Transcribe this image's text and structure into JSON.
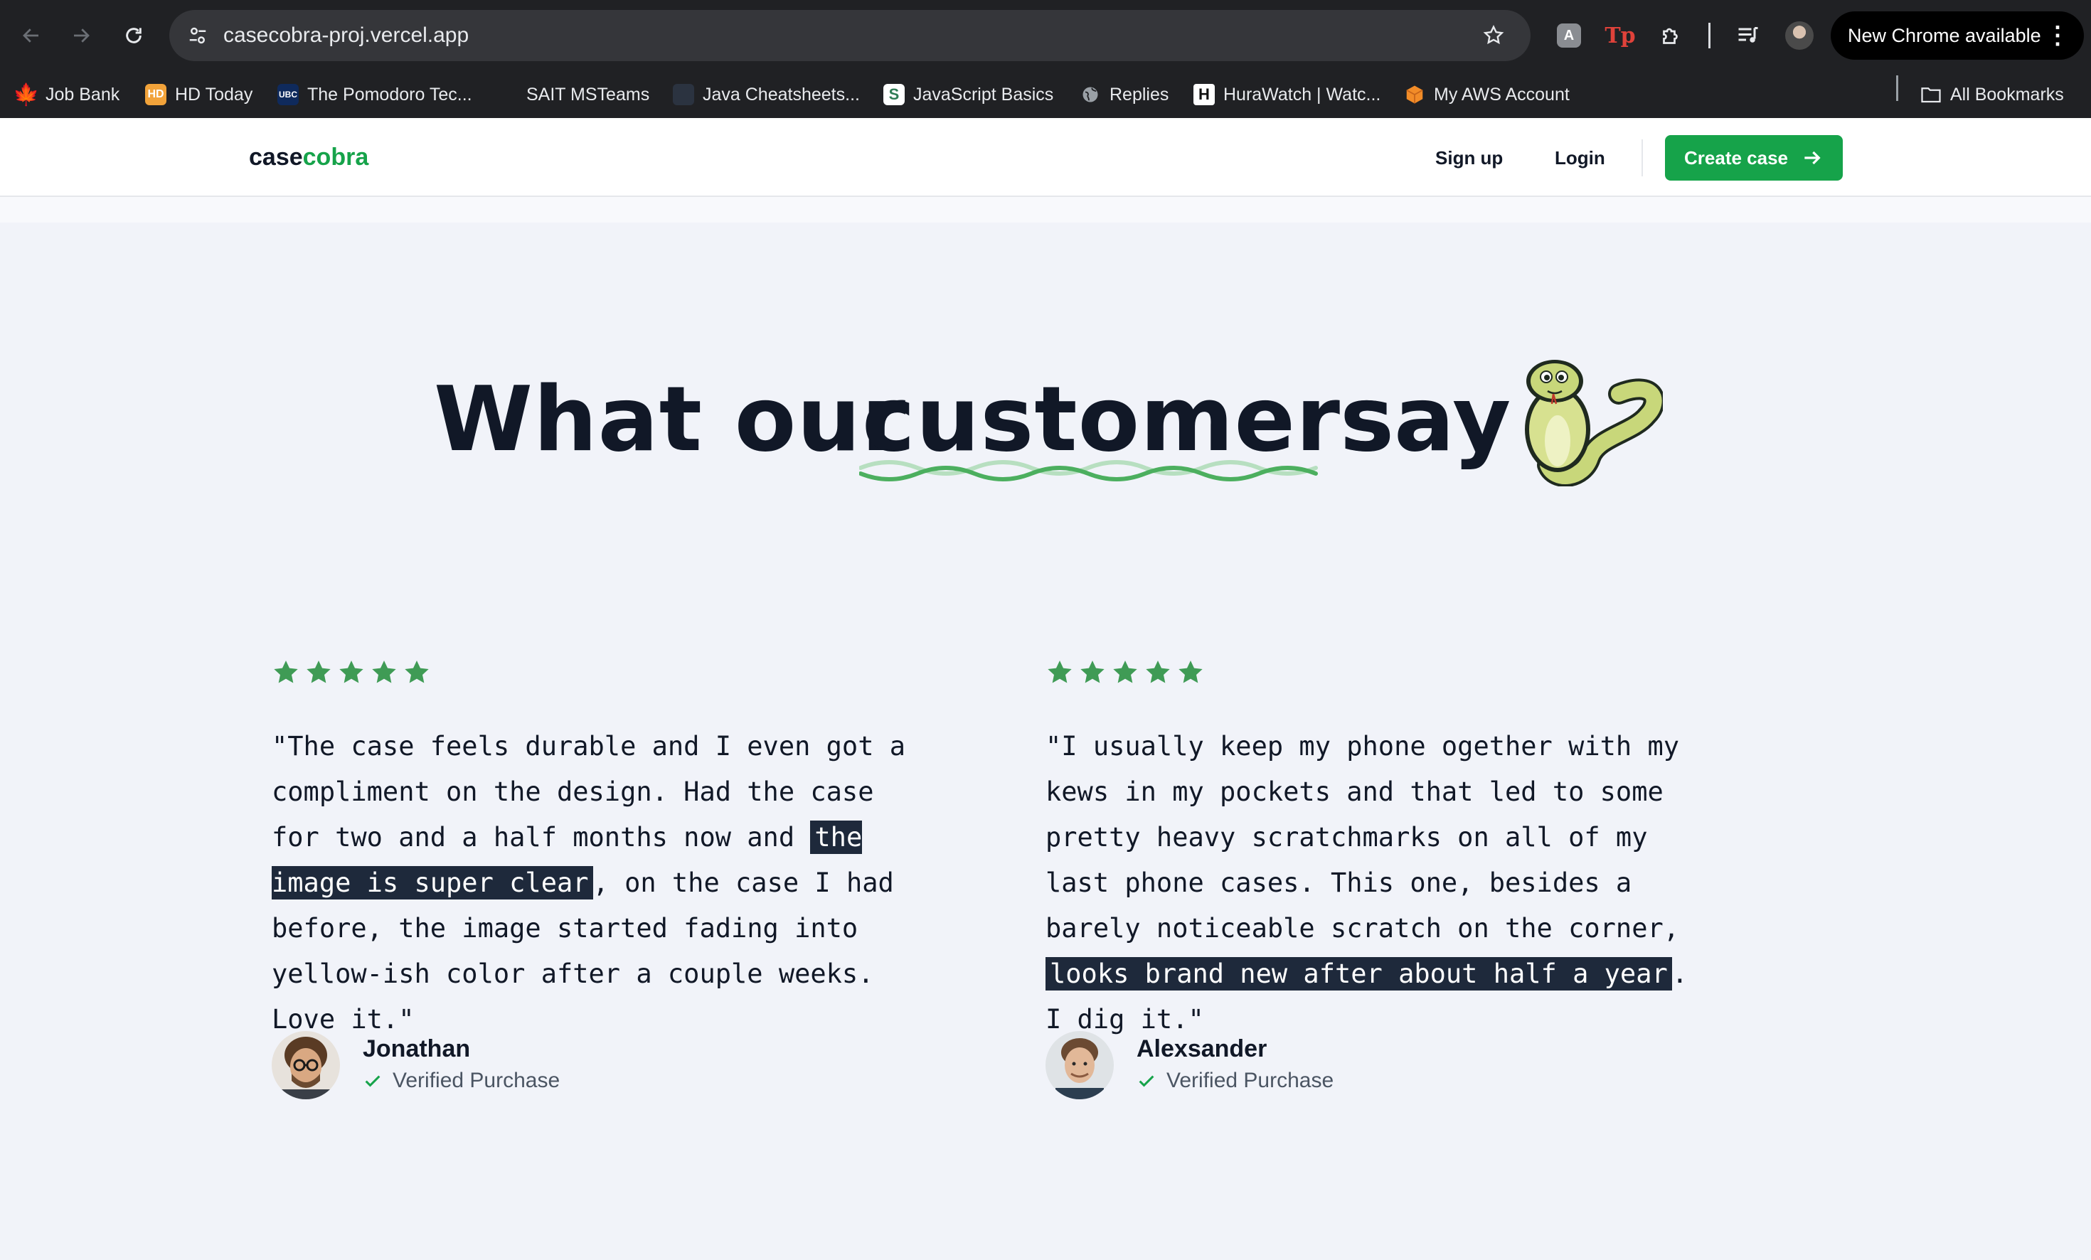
{
  "browser": {
    "url": "casecobra-proj.vercel.app",
    "new_chrome": "New Chrome available",
    "bookmarks": [
      {
        "label": "Job Bank",
        "icon": "maple-leaf-icon"
      },
      {
        "label": "HD Today",
        "icon": "hd-icon",
        "badge": "HD"
      },
      {
        "label": "The Pomodoro Tec...",
        "icon": "ubc-icon",
        "badge": "UBC"
      },
      {
        "label": "SAIT MSTeams",
        "icon": "microsoft-icon"
      },
      {
        "label": "Java Cheatsheets...",
        "icon": "java-icon"
      },
      {
        "label": "JavaScript Basics",
        "icon": "s-icon",
        "badge": "S"
      },
      {
        "label": "Replies",
        "icon": "globe-icon"
      },
      {
        "label": "HuraWatch | Watc...",
        "icon": "h-icon",
        "badge": "H"
      },
      {
        "label": "My AWS Account",
        "icon": "aws-icon"
      }
    ],
    "all_bookmarks": "All Bookmarks"
  },
  "header": {
    "logo_primary": "case",
    "logo_accent": "cobra",
    "sign_up": "Sign up",
    "login": "Login",
    "create_case": "Create case"
  },
  "hero": {
    "heading_1": "What our",
    "heading_highlight": "customers",
    "heading_2": "say"
  },
  "reviews": [
    {
      "rating": 5,
      "text_before": "\"The case feels durable and I even got a compliment on the design. Had the case for two and a half months now and ",
      "highlight": "the image is super clear",
      "text_after": ", on the case I had before, the image started fading into yellow-ish color after a couple weeks. Love it.\"",
      "name": "Jonathan",
      "verified": "Verified Purchase"
    },
    {
      "rating": 5,
      "text_before": "\"I usually keep my phone ogether with my kews in my pockets and that led to some pretty heavy scratchmarks on all of my last phone cases. This one, besides a barely noticeable scratch on the corner, ",
      "highlight": "looks brand new after about half a year",
      "text_after": ". I dig it.\"",
      "name": "Alexsander",
      "verified": "Verified Purchase"
    }
  ],
  "colors": {
    "brand_green": "#16a34a",
    "star_green": "#3f9b55",
    "heading": "#111827",
    "highlight_bg": "#1e293b",
    "page_bg": "#f1f3f9"
  }
}
